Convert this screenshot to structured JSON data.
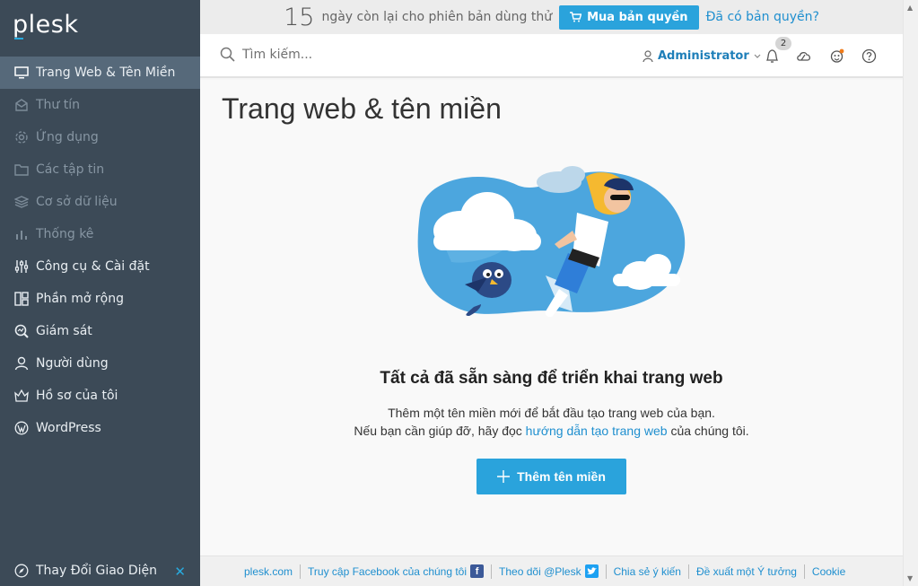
{
  "app": {
    "logo": "plesk"
  },
  "sidebar": {
    "items": [
      {
        "label": "Trang Web & Tên Miền",
        "icon": "monitor-icon",
        "active": true
      },
      {
        "label": "Thư tín",
        "icon": "mail-icon",
        "dim": true
      },
      {
        "label": "Ứng dụng",
        "icon": "gear-icon",
        "dim": true
      },
      {
        "label": "Các tập tin",
        "icon": "folder-icon",
        "dim": true
      },
      {
        "label": "Cơ sở dữ liệu",
        "icon": "database-icon",
        "dim": true
      },
      {
        "label": "Thống kê",
        "icon": "bar-chart-icon",
        "dim": true
      },
      {
        "label": "Công cụ & Cài đặt",
        "icon": "sliders-icon"
      },
      {
        "label": "Phần mở rộng",
        "icon": "extensions-icon"
      },
      {
        "label": "Giám sát",
        "icon": "monitoring-icon"
      },
      {
        "label": "Người dùng",
        "icon": "user-icon"
      },
      {
        "label": "Hồ sơ của tôi",
        "icon": "crown-icon"
      },
      {
        "label": "WordPress",
        "icon": "wordpress-icon"
      }
    ],
    "bottom": {
      "label": "Thay Đổi Giao Diện",
      "icon": "compass-icon",
      "close": "✕"
    },
    "collapse_glyph": "‹"
  },
  "trial": {
    "days": "15",
    "days_text": "ngày còn lại cho phiên bản dùng thử",
    "buy_label": "Mua bản quyền",
    "have_label": "Đã có bản quyền?"
  },
  "header": {
    "search_placeholder": "Tìm kiếm...",
    "user_label": "Administrator",
    "notification_count": "2"
  },
  "main": {
    "title": "Trang web & tên miền",
    "empty_title": "Tất cả đã sẵn sàng để triển khai trang web",
    "line1": "Thêm một tên miền mới để bắt đầu tạo trang web của bạn.",
    "line2_pre": "Nếu bạn cần giúp đỡ, hãy đọc ",
    "line2_link": "hướng dẫn tạo trang web",
    "line2_post": " của chúng tôi.",
    "add_button": "Thêm tên miền"
  },
  "footer": {
    "links": [
      "plesk.com",
      "Truy cập Facebook của chúng tôi",
      "Theo dõi @Plesk",
      "Chia sẻ ý kiến",
      "Đề xuất một Ý tưởng",
      "Cookie"
    ]
  },
  "colors": {
    "sidebar_bg": "#3c4a57",
    "sidebar_active": "#56697a",
    "accent": "#2aa3dc",
    "link": "#1f8fcf"
  }
}
